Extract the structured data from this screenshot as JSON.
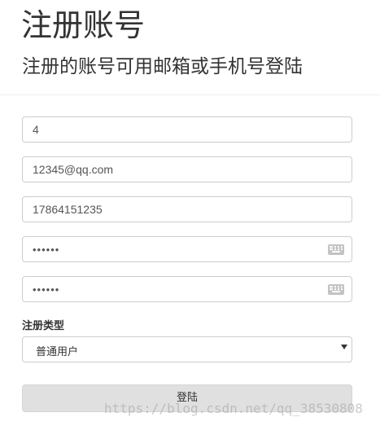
{
  "page": {
    "title": "注册账号",
    "subtitle": "注册的账号可用邮箱或手机号登陆"
  },
  "form": {
    "username": {
      "value": "4"
    },
    "email": {
      "value": "12345@qq.com"
    },
    "phone": {
      "value": "17864151235"
    },
    "password": {
      "masked": "••••••"
    },
    "confirm_password": {
      "masked": "••••••"
    },
    "account_type": {
      "label": "注册类型",
      "selected": "普通用户"
    },
    "submit_label": "登陆"
  },
  "icons": {
    "password_keyboard": "keyboard-icon",
    "select_arrow": "caret-down-icon"
  },
  "colors": {
    "border": "#cccccc",
    "button_bg": "#e0e0e0",
    "text": "#333333"
  },
  "watermark": "https://blog.csdn.net/qq_38530808"
}
